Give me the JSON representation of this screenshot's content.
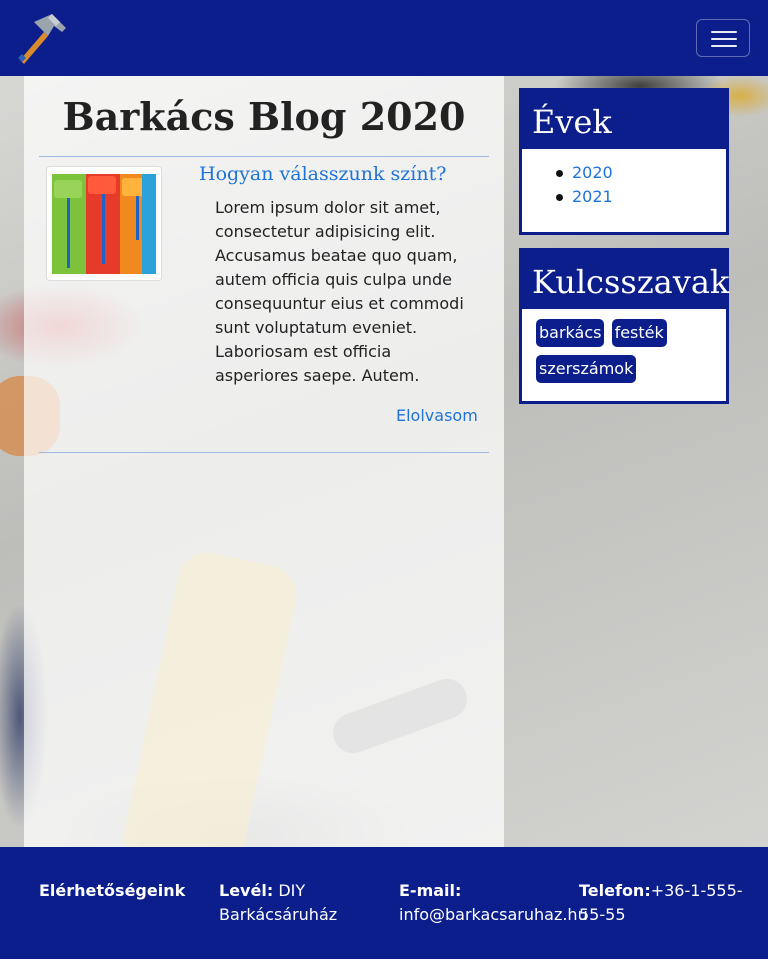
{
  "navbar": {
    "logo_icon": "hammer-icon",
    "toggle_icon": "hamburger-menu-icon"
  },
  "main": {
    "title": "Barkács Blog 2020",
    "post": {
      "title": "Hogyan válasszunk színt?",
      "thumbnail_icon": "paint-rollers-image",
      "body": "Lorem ipsum dolor sit amet, consectetur adipisicing elit. Accusamus beatae quo quam, autem officia quis culpa unde consequuntur eius et commodi sunt voluptatum eveniet. Laboriosam est officia asperiores saepe. Autem.",
      "read_more": "Elolvasom"
    }
  },
  "sidebar": {
    "years": {
      "title": "Évek",
      "items": [
        "2020",
        "2021"
      ]
    },
    "keywords": {
      "title": "Kulcsszavak",
      "tags": [
        "barkács",
        "festék",
        "szerszámok"
      ]
    }
  },
  "footer": {
    "contacts_label": "Elérhetőségeink",
    "mail_label": "Levél:",
    "mail_value": "DIY Barkácsáruház",
    "email_label": "E-mail:",
    "email_value": "info@barkacsaruhaz.hu",
    "phone_label": "Telefon:",
    "phone_value": "+36-1-555-55-55"
  },
  "colors": {
    "brand": "#0b1e8c",
    "link": "#1e73d8"
  }
}
